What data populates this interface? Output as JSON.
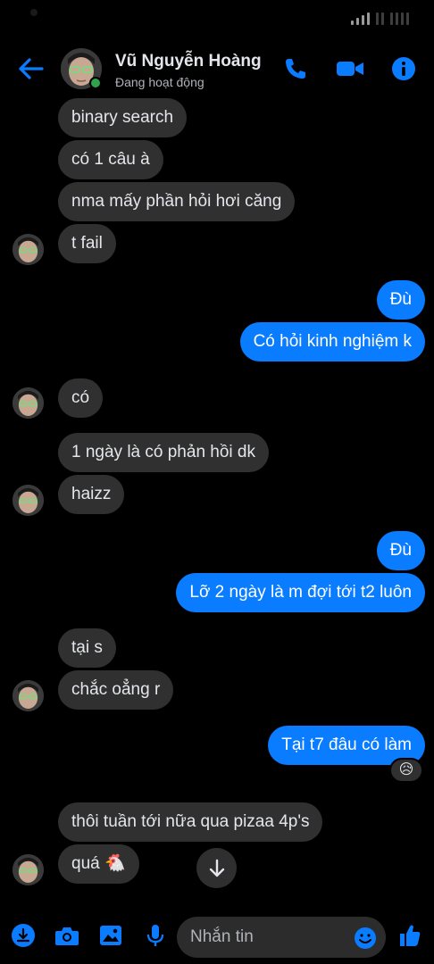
{
  "status_bar": {
    "colors": {
      "signal": "#9a9a9a"
    }
  },
  "header": {
    "name": "Vũ Nguyễn Hoàng",
    "status": "Đang hoạt động",
    "accent": "#0a7cff",
    "online_color": "#31a24c",
    "icons": [
      "back-arrow-icon",
      "phone-icon",
      "video-camera-icon",
      "info-icon"
    ]
  },
  "messages": [
    {
      "from": "them",
      "text": "binary search"
    },
    {
      "from": "them",
      "text": "có 1 câu à"
    },
    {
      "from": "them",
      "text": "nma mấy phần hỏi hơi căng"
    },
    {
      "from": "them",
      "text": "t fail"
    },
    {
      "from": "me",
      "text": "Đù"
    },
    {
      "from": "me",
      "text": "Có hỏi kinh nghiệm k"
    },
    {
      "from": "them",
      "text": "có"
    },
    {
      "from": "them",
      "text": "1 ngày là có phản hồi dk"
    },
    {
      "from": "them",
      "text": "haizz"
    },
    {
      "from": "me",
      "text": "Đù"
    },
    {
      "from": "me",
      "text": "Lỡ 2 ngày là m đợi tới t2 luôn"
    },
    {
      "from": "them",
      "text": "tại s"
    },
    {
      "from": "them",
      "text": "chắc oẳng r"
    },
    {
      "from": "me",
      "text": "Tại t7 đâu có làm",
      "reaction": "😥"
    },
    {
      "from": "them",
      "text": "thôi tuần tới nữa qua pizaa 4p's"
    },
    {
      "from": "them",
      "text": "quá 🐔"
    }
  ],
  "composer": {
    "placeholder": "Nhắn tin",
    "icons": [
      "menu-icon",
      "camera-icon",
      "image-icon",
      "microphone-icon",
      "emoji-icon",
      "like-icon"
    ]
  },
  "colors": {
    "background": "#000000",
    "incoming_bubble": "#303030",
    "outgoing_bubble": "#0a7cff",
    "text": "#e4e6eb",
    "secondary_text": "#b0b3b8"
  }
}
